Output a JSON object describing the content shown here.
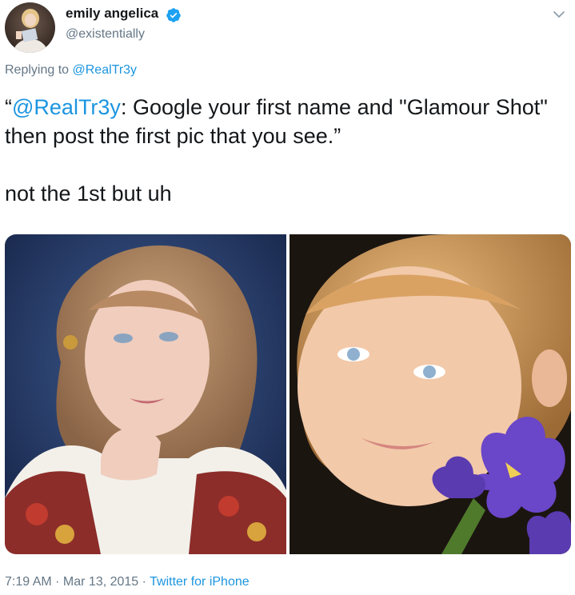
{
  "author": {
    "display_name": "emily angelica",
    "handle": "@existentially",
    "verified_icon": "verified-badge-icon",
    "avatar_icon": "avatar-photo"
  },
  "reply": {
    "prefix": "Replying to ",
    "target": "@RealTr3y"
  },
  "tweet": {
    "quote_open": "“",
    "quote_mention": "@RealTr3y",
    "quote_text": ": Google your first name and \"Glamour Shot\" then post the first pic that you see.”",
    "comment": "not the 1st but uh"
  },
  "media": {
    "photos": [
      "glamour-shot-photo-1",
      "glamour-shot-photo-2"
    ]
  },
  "footer": {
    "time": "7:19 AM",
    "separator1": " · ",
    "date": "Mar 13, 2015",
    "separator2": " · ",
    "source": "Twitter for iPhone"
  },
  "colors": {
    "link": "#1b95e0",
    "secondary_text": "#657786",
    "primary_text": "#14171a",
    "verified": "#1da1f2"
  }
}
